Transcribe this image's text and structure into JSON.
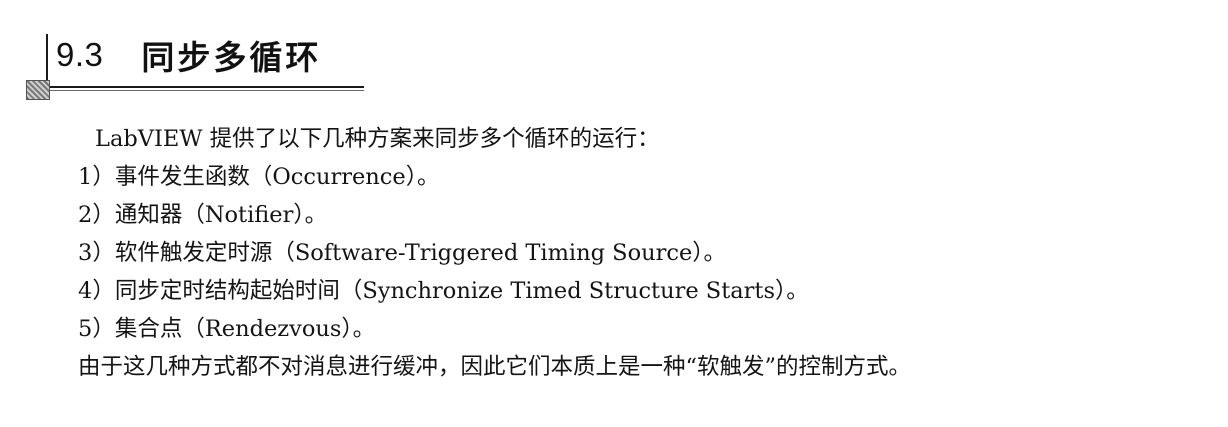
{
  "section": {
    "number": "9.3",
    "title": "同步多循环"
  },
  "paragraph": {
    "intro": "LabVIEW 提供了以下几种方案来同步多个循环的运行：",
    "items": [
      "1）事件发生函数（Occurrence）。",
      "2）通知器（Notifier）。",
      "3）软件触发定时源（Software-Triggered Timing Source）。",
      "4）同步定时结构起始时间（Synchronize Timed Structure Starts）。",
      "5）集合点（Rendezvous）。"
    ],
    "conclusion": "由于这几种方式都不对消息进行缓冲，因此它们本质上是一种“软触发”的控制方式。"
  }
}
